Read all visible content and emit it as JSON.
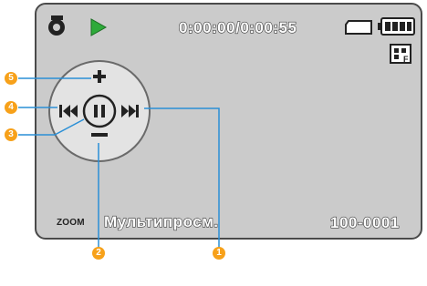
{
  "status": {
    "timecode": "0:00:00/0:00:55",
    "zoom_label": "ZOOM",
    "mode_label": "Мультипросм.",
    "folder_file": "100-0001"
  },
  "icons": [
    "playback-mode-icon",
    "play-icon",
    "memory-card-icon",
    "battery-icon",
    "image-quality-icon",
    "plus-icon",
    "minus-icon",
    "skip-back-icon",
    "pause-icon",
    "skip-forward-icon"
  ],
  "callouts": [
    "1",
    "2",
    "3",
    "4",
    "5"
  ],
  "colors": {
    "callout": "#f7a11a",
    "line": "#2a8fd6",
    "play": "#2eaa3a",
    "screen": "#cbcbcb"
  }
}
